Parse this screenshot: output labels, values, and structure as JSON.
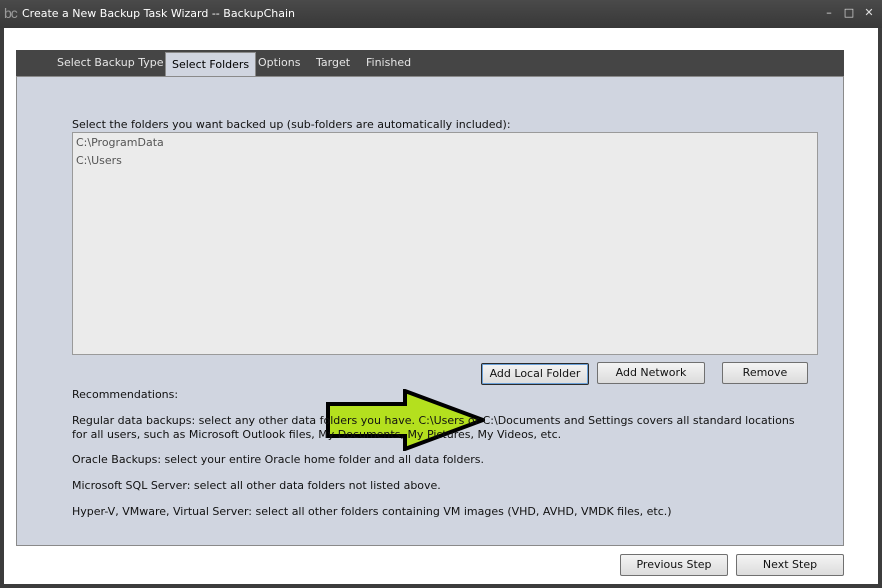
{
  "window": {
    "logo": "bc",
    "title": "Create a New Backup Task Wizard -- BackupChain",
    "controls": {
      "minimize": "–",
      "maximize": "□",
      "close": "✕"
    }
  },
  "tabs": [
    {
      "label": "Select Backup Type"
    },
    {
      "label": "Select Folders"
    },
    {
      "label": "Options"
    },
    {
      "label": "Target"
    },
    {
      "label": "Finished"
    }
  ],
  "folders": {
    "prompt": "Select the folders you want backed up (sub-folders are automatically included):",
    "items": [
      "C:\\ProgramData",
      "C:\\Users"
    ],
    "add_local_label": "Add Local Folder",
    "add_network_label": "Add Network",
    "remove_label": "Remove"
  },
  "recommendations": {
    "heading": "Recommendations:",
    "regular_line1": "Regular data backups: select any other data folders you have. C:\\Users or C:\\Documents and Settings covers all standard locations",
    "regular_line2": "for all users, such as Microsoft Outlook files, My Documents, My Pictures, My Videos, etc.",
    "oracle": "Oracle Backups: select your entire Oracle home folder and all data folders.",
    "sql": "Microsoft SQL Server: select all other data folders not listed above.",
    "hyperv": "Hyper-V, VMware, Virtual Server: select all other folders containing VM images (VHD, AVHD, VMDK files, etc.)"
  },
  "footer": {
    "previous_label": "Previous Step",
    "next_label": "Next Step"
  },
  "colors": {
    "accent_arrow": "#b4e01e",
    "panel": "#d0d5e0",
    "titlebar": "#3c3c3c"
  }
}
